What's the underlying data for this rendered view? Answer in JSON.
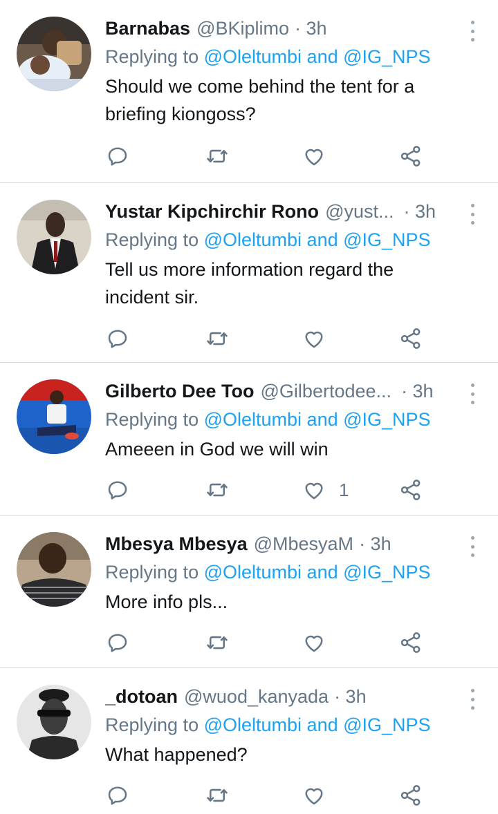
{
  "colors": {
    "link": "#1da1f2",
    "secondary": "#657786",
    "text": "#14171a",
    "divider": "#d6dadd"
  },
  "icons": {
    "reply": "reply-icon",
    "retweet": "retweet-icon",
    "like": "heart-icon",
    "share": "share-icon",
    "menu": "more-vertical-icon"
  },
  "tweets": [
    {
      "name": "Barnabas",
      "handle": "@BKiplimo",
      "time": "· 3h",
      "replying_prefix": "Replying to ",
      "mention1": "@Oleltumbi",
      "and": " and ",
      "mention2": "@IG_NPS",
      "text": "Should we come behind the tent for a briefing kiongoss?",
      "like_count": ""
    },
    {
      "name": "Yustar Kipchirchir Rono",
      "handle": "@yust...",
      "time": "· 3h",
      "replying_prefix": "Replying to ",
      "mention1": "@Oleltumbi",
      "and": " and ",
      "mention2": "@IG_NPS",
      "text": "Tell us more information regard the incident sir.",
      "like_count": ""
    },
    {
      "name": "Gilberto Dee Too",
      "handle": "@Gilbertodee...",
      "time": "· 3h",
      "replying_prefix": "Replying to ",
      "mention1": "@Oleltumbi",
      "and": " and ",
      "mention2": "@IG_NPS",
      "text": "Ameeen in God we will win",
      "like_count": "1"
    },
    {
      "name": "Mbesya Mbesya",
      "handle": "@MbesyaM",
      "time": "· 3h",
      "replying_prefix": "Replying to ",
      "mention1": "@Oleltumbi",
      "and": " and ",
      "mention2": "@IG_NPS",
      "text": "More info pls...",
      "like_count": ""
    },
    {
      "name": "_dotoan",
      "handle": "@wuod_kanyada",
      "time": "· 3h",
      "replying_prefix": "Replying to ",
      "mention1": "@Oleltumbi",
      "and": " and ",
      "mention2": "@IG_NPS",
      "text": "What happened?",
      "like_count": ""
    }
  ]
}
